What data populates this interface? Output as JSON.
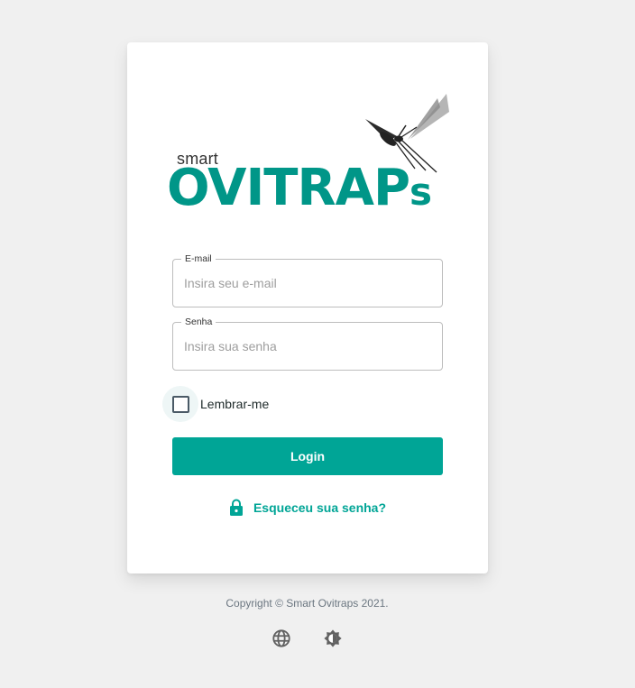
{
  "logo": {
    "smart": "smart",
    "word_main": "OVITRAP",
    "word_suffix": "s",
    "brand_color": "#009688"
  },
  "form": {
    "email": {
      "legend": "E-mail",
      "placeholder": "Insira seu e-mail",
      "value": ""
    },
    "password": {
      "legend": "Senha",
      "placeholder": "Insira sua senha",
      "value": ""
    },
    "remember_label": "Lembrar-me",
    "remember_checked": false,
    "login_label": "Login",
    "forgot_label": "Esqueceu sua senha?"
  },
  "footer": {
    "copyright": "Copyright © Smart Ovitraps 2021.",
    "language_icon": "globe-icon",
    "theme_icon": "brightness-icon"
  },
  "colors": {
    "accent": "#00a596",
    "background": "#f0f0f0"
  }
}
